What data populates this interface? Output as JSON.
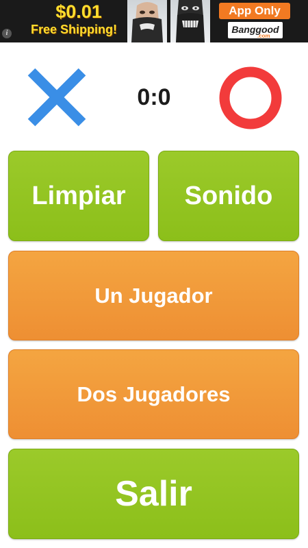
{
  "ad": {
    "price": "$0.01",
    "shipping": "Free Shipping!",
    "cta": "App Only",
    "brand": "Banggood",
    "brand_suffix": ".com",
    "info_glyph": "i",
    "icons": [
      "info-icon",
      "face-mask-product-photo",
      "skull-mask-product-photo"
    ],
    "colors": {
      "price_text": "#ffde2e",
      "cta_bg": "#f27a22"
    }
  },
  "game": {
    "score": "0:0",
    "player_x_icon": "x-icon",
    "player_o_icon": "o-icon",
    "colors": {
      "x": "#3a8ee6",
      "o": "#f23b3b"
    }
  },
  "buttons": {
    "clear": "Limpiar",
    "sound": "Sonido",
    "one_player": "Un Jugador",
    "two_players": "Dos Jugadores",
    "exit": "Salir"
  },
  "colors": {
    "green_button": "#93c520",
    "orange_button": "#f19b3a",
    "button_text": "#ffffff"
  }
}
